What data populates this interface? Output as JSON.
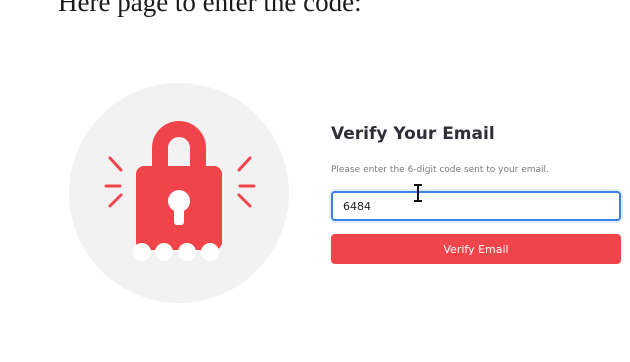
{
  "caption": {
    "text": "Here page to enter the code:"
  },
  "card": {
    "title": "Verify Your Email",
    "subtitle": "Please enter the 6-digit code sent to your email.",
    "code_value": "6484",
    "button_label": "Verify Email"
  },
  "icons": {
    "illustration": "padlock-with-keyhole-icon",
    "cursor": "text-cursor-icon"
  },
  "colors": {
    "accent_red": "#ef4449",
    "focus_blue": "#3b82e8",
    "title_text": "#2f2f3a",
    "circle_bg": "#f2f2f3"
  }
}
